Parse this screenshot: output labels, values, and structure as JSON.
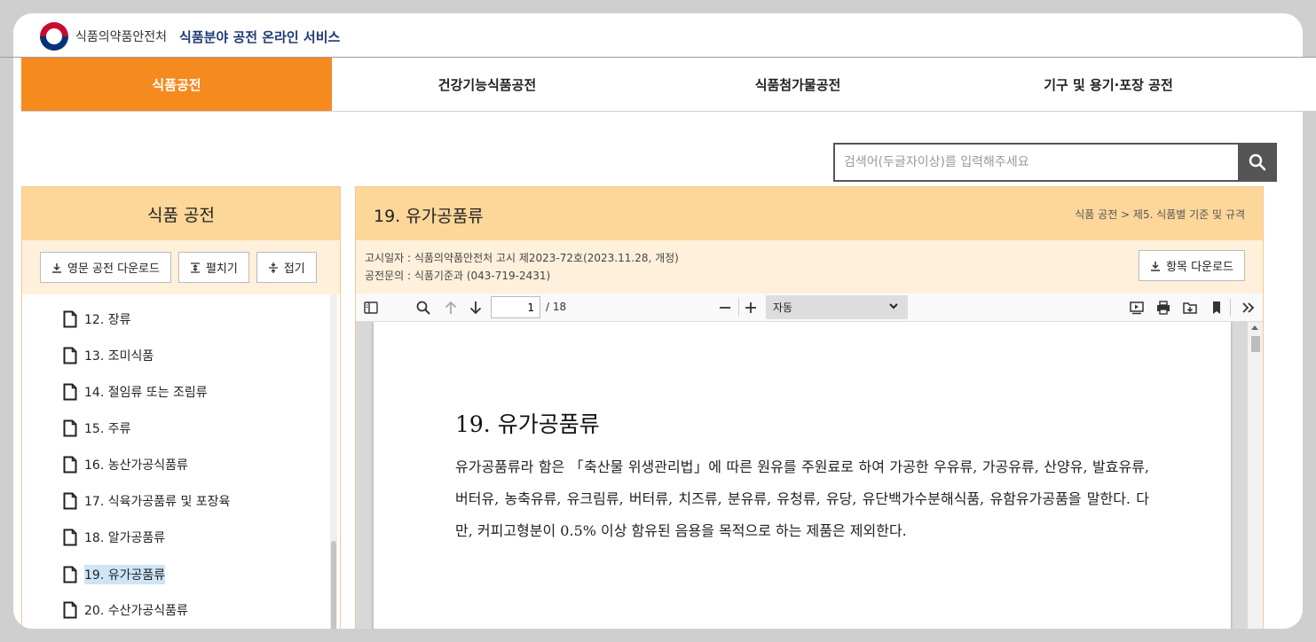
{
  "header": {
    "org_name": "식품의약품안전처",
    "service_name": "식품분야 공전 온라인 서비스"
  },
  "tabs": [
    {
      "label": "식품공전",
      "active": true
    },
    {
      "label": "건강기능식품공전",
      "active": false
    },
    {
      "label": "식품첨가물공전",
      "active": false
    },
    {
      "label": "기구 및 용기·포장 공전",
      "active": false
    }
  ],
  "search": {
    "placeholder": "검색어(두글자이상)를 입력해주세요",
    "value": "",
    "icon": "search-icon"
  },
  "sidebar": {
    "title": "식품 공전",
    "buttons": {
      "english_download": "영문 공전 다운로드",
      "expand": "펼치기",
      "collapse": "접기"
    },
    "items": [
      {
        "label": "12. 장류",
        "selected": false
      },
      {
        "label": "13. 조미식품",
        "selected": false
      },
      {
        "label": "14. 절임류 또는 조림류",
        "selected": false
      },
      {
        "label": "15. 주류",
        "selected": false
      },
      {
        "label": "16. 농산가공식품류",
        "selected": false
      },
      {
        "label": "17. 식육가공품류 및 포장육",
        "selected": false
      },
      {
        "label": "18. 알가공품류",
        "selected": false
      },
      {
        "label": "19. 유가공품류",
        "selected": true
      },
      {
        "label": "20. 수산가공식품류",
        "selected": false
      }
    ]
  },
  "content": {
    "title": "19. 유가공품류",
    "breadcrumb": "식품 공전 >  제5. 식품별 기준 및 규격",
    "notice_line": "고시일자 : 식품의약품안전처 고시 제2023-72호(2023.11.28, 개정)",
    "inquiry_line": "공전문의 : 식품기준과 (043-719-2431)",
    "item_download": "항목 다운로드"
  },
  "pdf_viewer": {
    "current_page": "1",
    "total_pages": "/ 18",
    "zoom": "자동",
    "doc_heading": "19.  유가공품류",
    "doc_paragraph": "유가공품류라 함은 「축산물 위생관리법」에 따른 원유를 주원료로 하여 가공한 우유류, 가공유류, 산양유, 발효유류, 버터유, 농축유류, 유크림류, 버터류, 치즈류, 분유류, 유청류, 유당, 유단백가수분해식품, 유함유가공품을 말한다. 다만, 커피고형분이 0.5% 이상 함유된 음용을 목적으로 하는 제품은 제외한다."
  },
  "colors": {
    "accent": "#f58a1f",
    "panel_header": "#fdd69a",
    "panel_sub": "#fff0dc",
    "brand_navy": "#1e3b73"
  }
}
